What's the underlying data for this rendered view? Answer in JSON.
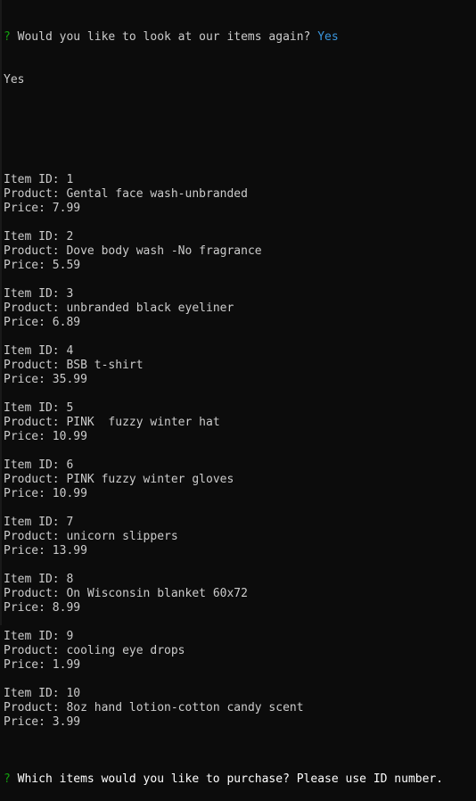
{
  "terminal": {
    "prompt_mark": "?",
    "first_question": "Would you like to look at our items again?",
    "first_answer": "Yes",
    "echo": "Yes",
    "item_id_label": "Item ID: ",
    "product_label": "Product: ",
    "price_label": "Price: ",
    "items": [
      {
        "id": "1",
        "product": "Gental face wash-unbranded",
        "price": "7.99"
      },
      {
        "id": "2",
        "product": "Dove body wash -No fragrance",
        "price": "5.59"
      },
      {
        "id": "3",
        "product": "unbranded black eyeliner",
        "price": "6.89"
      },
      {
        "id": "4",
        "product": "BSB t-shirt",
        "price": "35.99"
      },
      {
        "id": "5",
        "product": "PINK  fuzzy winter hat",
        "price": "10.99"
      },
      {
        "id": "6",
        "product": "PINK fuzzy winter gloves",
        "price": "10.99"
      },
      {
        "id": "7",
        "product": "unicorn slippers",
        "price": "13.99"
      },
      {
        "id": "8",
        "product": "On Wisconsin blanket 60x72",
        "price": "8.99"
      },
      {
        "id": "9",
        "product": "cooling eye drops",
        "price": "1.99"
      },
      {
        "id": "10",
        "product": "8oz hand lotion-cotton candy scent",
        "price": "3.99"
      }
    ],
    "second_question": "Which items would you like to purchase? Please use ID number.",
    "colors": {
      "background": "#0c0c0c",
      "text": "#cccccc",
      "prompt_mark": "#13a10e",
      "answer": "#3a96dd"
    }
  }
}
